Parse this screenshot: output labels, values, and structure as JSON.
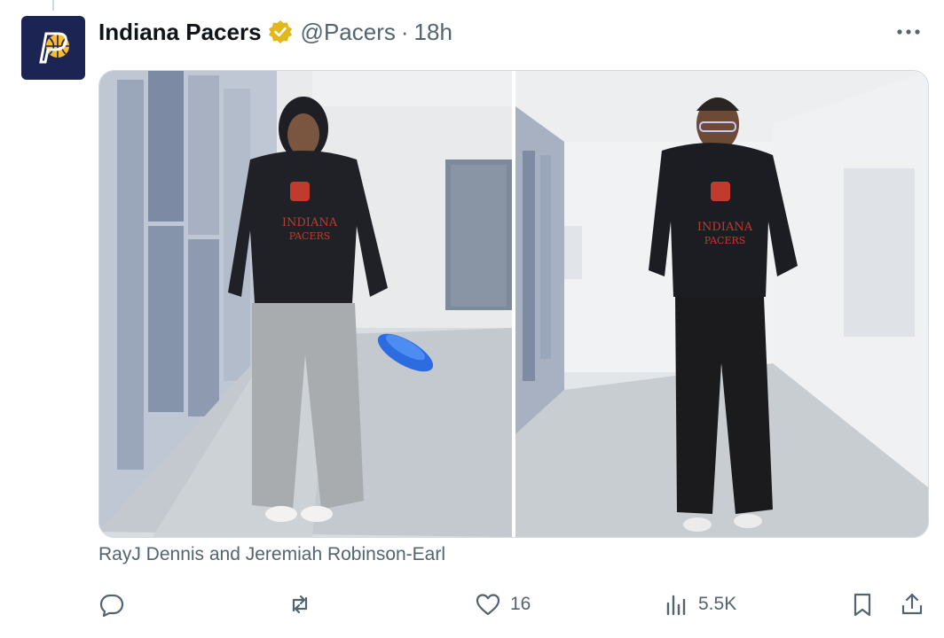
{
  "author": {
    "name": "Indiana Pacers",
    "handle": "@Pacers",
    "separator": "·",
    "time": "18h"
  },
  "caption": "RayJ Dennis and Jeremiah Robinson-Earl",
  "media": {
    "photos": [
      {
        "alt": ""
      },
      {
        "alt": ""
      }
    ]
  },
  "actions": {
    "reply_count": "",
    "repost_count": "",
    "like_count": "16",
    "views_count": "5.5K"
  },
  "icons": {
    "verified": "verified-badge-icon",
    "more": "more-icon",
    "reply": "reply-icon",
    "repost": "repost-icon",
    "like": "heart-icon",
    "views": "views-icon",
    "bookmark": "bookmark-icon",
    "share": "share-icon"
  },
  "colors": {
    "text_primary": "#0f1419",
    "text_secondary": "#536471",
    "verified_gold": "#e2b719",
    "brand_navy": "#1b2452",
    "brand_gold": "#fdbb30"
  }
}
